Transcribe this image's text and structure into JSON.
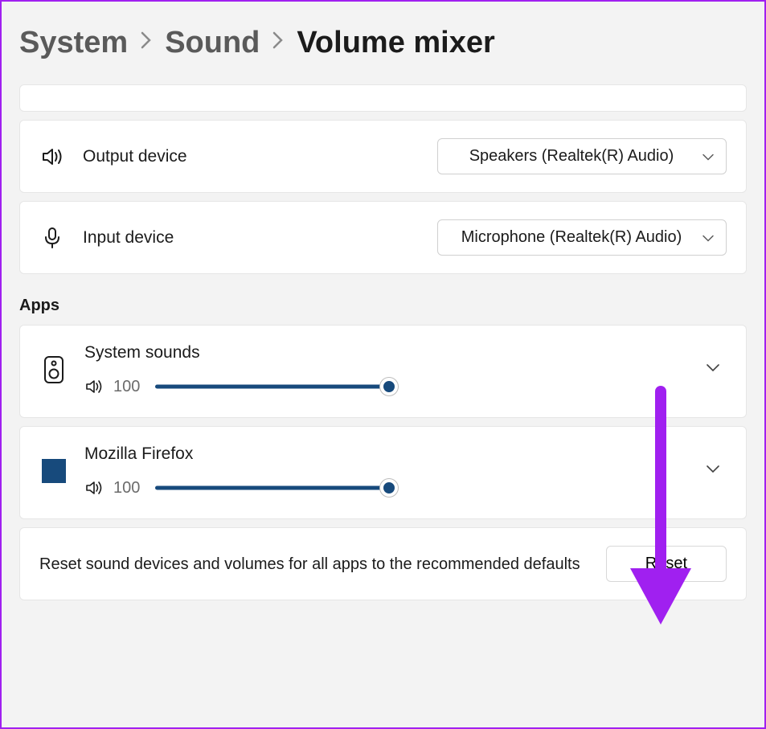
{
  "breadcrumb": {
    "level1": "System",
    "level2": "Sound",
    "current": "Volume mixer"
  },
  "output": {
    "label": "Output device",
    "selected": "Speakers (Realtek(R) Audio)"
  },
  "input": {
    "label": "Input device",
    "selected": "Microphone (Realtek(R) Audio)"
  },
  "apps_header": "Apps",
  "apps": [
    {
      "name": "System sounds",
      "volume": 100
    },
    {
      "name": "Mozilla Firefox",
      "volume": 100
    }
  ],
  "reset": {
    "text": "Reset sound devices and volumes for all apps to the recommended defaults",
    "button": "Reset"
  }
}
